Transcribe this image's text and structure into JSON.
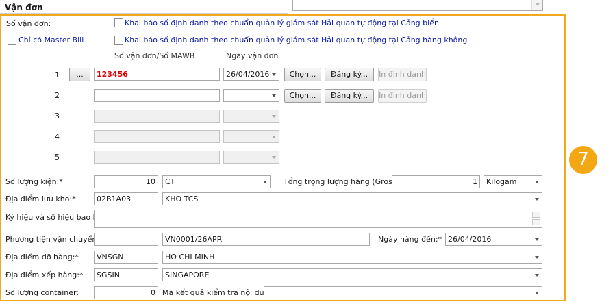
{
  "section_title": "Vận đơn",
  "badge": "7",
  "labels": {
    "so_van_don": "Số vận đơn:",
    "chk_cang_bien": "Khai báo số định danh theo chuẩn quản lý giám sát Hải quan tự động tại Cảng biển",
    "chk_master_bill": "Chỉ có Master Bill",
    "chk_cang_hang_khong": "Khai báo số định danh theo chuẩn quản lý giám sát Hải quan tự động tại Cảng hàng không",
    "col_so_van_don": "Số vận đơn/Số MAWB",
    "col_ngay_van_don": "Ngày vận đơn",
    "so_luong_kien": "Số lượng kiện:*",
    "tong_trong_luong": "Tổng trọng lượng hàng (Gross):",
    "dia_diem_luu_kho": "Địa điểm lưu kho:*",
    "ky_hieu": "Ký hiệu và số hiệu bao bì:",
    "phuong_tien": "Phương tiện vận chuyển:",
    "ngay_hang_den": "Ngày hàng đến:*",
    "dia_diem_do_hang": "Địa điểm dỡ hàng:*",
    "dia_diem_xep_hang": "Địa điểm xếp hàng:*",
    "so_luong_container": "Số lượng container:",
    "ma_ket_qua": "Mã kết quả kiểm tra nội dung:"
  },
  "rows": [
    {
      "num": "1",
      "dots": "...",
      "so_van_don": "123456",
      "ngay": "26/04/2016",
      "chon": "Chọn...",
      "dang_ky": "Đăng ký...",
      "in_dinh_danh": "In định danh"
    },
    {
      "num": "2",
      "so_van_don": "",
      "ngay": "",
      "chon": "Chọn...",
      "dang_ky": "Đăng ký...",
      "in_dinh_danh": "In định danh"
    },
    {
      "num": "3",
      "so_van_don": "",
      "ngay": ""
    },
    {
      "num": "4",
      "so_van_don": "",
      "ngay": ""
    },
    {
      "num": "5",
      "so_van_don": "",
      "ngay": ""
    }
  ],
  "fields": {
    "so_luong_kien": "10",
    "don_vi_kien": "CT",
    "tong_trong_luong": "1",
    "don_vi_trong_luong": "Kilogam",
    "ma_luu_kho": "02B1A03",
    "ten_luu_kho": "KHO TCS",
    "ky_hieu": "",
    "phuong_tien_ma": "",
    "phuong_tien_ten": "VN0001/26APR",
    "ngay_hang_den": "26/04/2016",
    "ma_do_hang": "VNSGN",
    "ten_do_hang": "HO CHI MINH",
    "ma_xep_hang": "SGSIN",
    "ten_xep_hang": "SINGAPORE",
    "so_luong_container": "0",
    "ma_ket_qua": ""
  }
}
